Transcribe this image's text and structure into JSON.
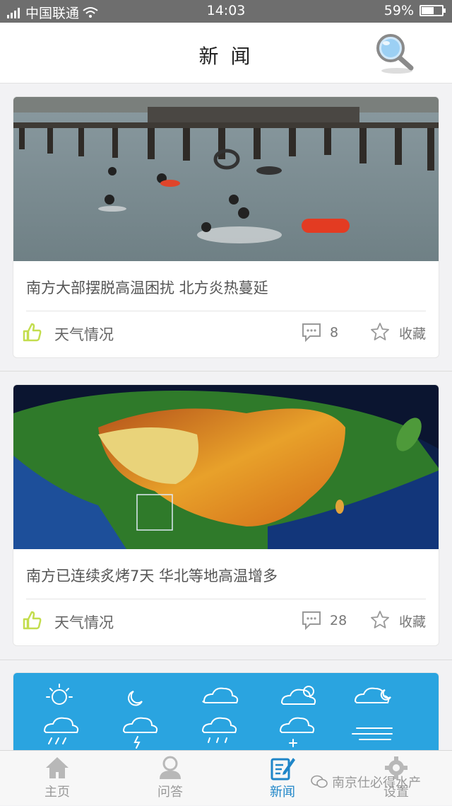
{
  "status_bar": {
    "carrier": "中国联通",
    "time": "14:03",
    "battery": "59%",
    "battery_level": 0.59
  },
  "header": {
    "title": "新 闻"
  },
  "news": [
    {
      "headline": "南方大部摆脱高温困扰 北方炎热蔓延",
      "category": "天气情况",
      "comments": "8",
      "favorite_label": "收藏"
    },
    {
      "headline": "南方已连续炙烤7天 华北等地高温增多",
      "category": "天气情况",
      "comments": "28",
      "favorite_label": "收藏"
    }
  ],
  "tabs": [
    {
      "label": "主页",
      "icon": "home-icon",
      "active": false
    },
    {
      "label": "问答",
      "icon": "user-icon",
      "active": false
    },
    {
      "label": "新闻",
      "icon": "news-edit-icon",
      "active": true
    },
    {
      "label": "设置",
      "icon": "gear-icon",
      "active": false
    }
  ],
  "watermark": "南京仕必得水产",
  "colors": {
    "accent": "#1f86c8",
    "weather_panel": "#2aa4e0",
    "like_icon": "#c9e25a"
  }
}
